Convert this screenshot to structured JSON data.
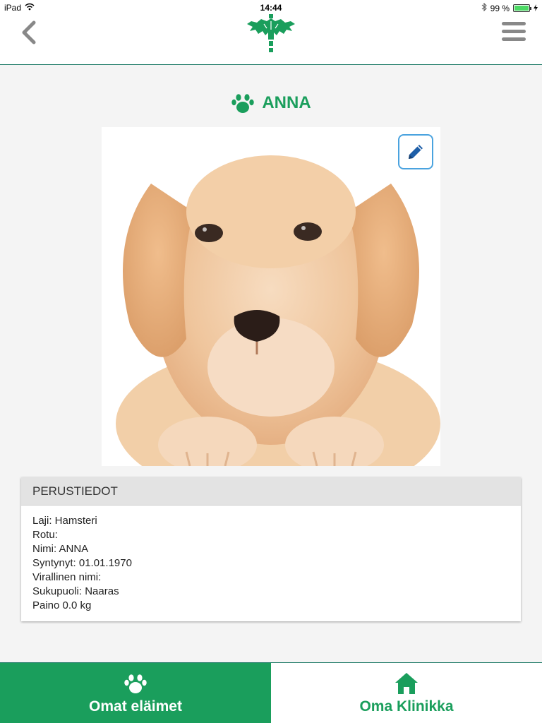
{
  "status_bar": {
    "device": "iPad",
    "time": "14:44",
    "battery": "99 %",
    "battery_level": 0.99
  },
  "pet": {
    "name": "ANNA"
  },
  "card": {
    "title": "PERUSTIEDOT",
    "lines": [
      "Laji: Hamsteri",
      "Rotu:",
      "Nimi: ANNA",
      "Syntynyt: 01.01.1970",
      "Virallinen nimi:",
      "Sukupuoli: Naaras",
      "Paino 0.0 kg"
    ]
  },
  "tabs": [
    {
      "label": "Omat eläimet",
      "icon": "paw-icon",
      "active": true
    },
    {
      "label": "Oma Klinikka",
      "icon": "home-icon",
      "active": false
    }
  ],
  "colors": {
    "accent": "#1a9e5c",
    "edit_border": "#4aa3df",
    "edit_icon": "#1e5fa8",
    "nav_gray": "#888888"
  }
}
